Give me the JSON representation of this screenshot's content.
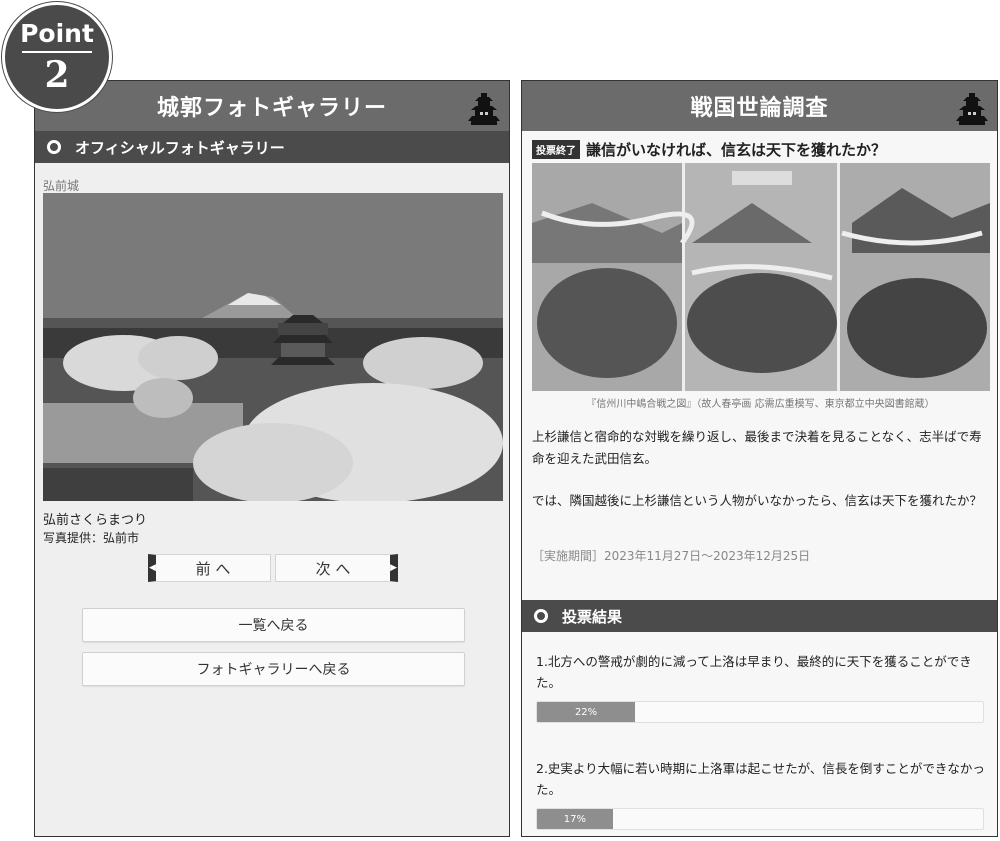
{
  "badge": {
    "word": "Point",
    "number": "2"
  },
  "left": {
    "header_title": "城郭フォトギャラリー",
    "section_title": "オフィシャルフォトギャラリー",
    "castle_name": "弘前城",
    "photo_title": "弘前さくらまつり",
    "photo_credit": "写真提供：弘前市",
    "prev_label": "前 へ",
    "next_label": "次 へ",
    "back_to_list": "一覧へ戻る",
    "back_to_gallery": "フォトギャラリーへ戻る"
  },
  "right": {
    "header_title": "戦国世論調査",
    "status_badge": "投票終了",
    "question": "謙信がいなければ、信玄は天下を獲れたか？",
    "painting_caption": "『信州川中嶋合戦之図』（故人春亭画 応需広重模写、東京都立中央図書館蔵）",
    "body1": "上杉謙信と宿命的な対戦を繰り返し、最後まで決着を見ることなく、志半ばで寿命を迎えた武田信玄。",
    "body2": "では、隣国越後に上杉謙信という人物がいなかったら、信玄は天下を獲れたか？",
    "period": "［実施期間］2023年11月27日〜2023年12月25日",
    "results_title": "投票結果",
    "results": [
      {
        "text": "1.北方への警戒が劇的に減って上洛は早まり、最終的に天下を獲ることができた。",
        "percent_label": "22%",
        "percent": 22
      },
      {
        "text": "2.史実より大幅に若い時期に上洛軍は起こせたが、信長を倒すことができなかった。",
        "percent_label": "17%",
        "percent": 17
      }
    ]
  },
  "colors": {
    "header": "#6b6b6b",
    "section_bar": "#4b4b4b",
    "progress_fill": "#8e8e8e"
  }
}
